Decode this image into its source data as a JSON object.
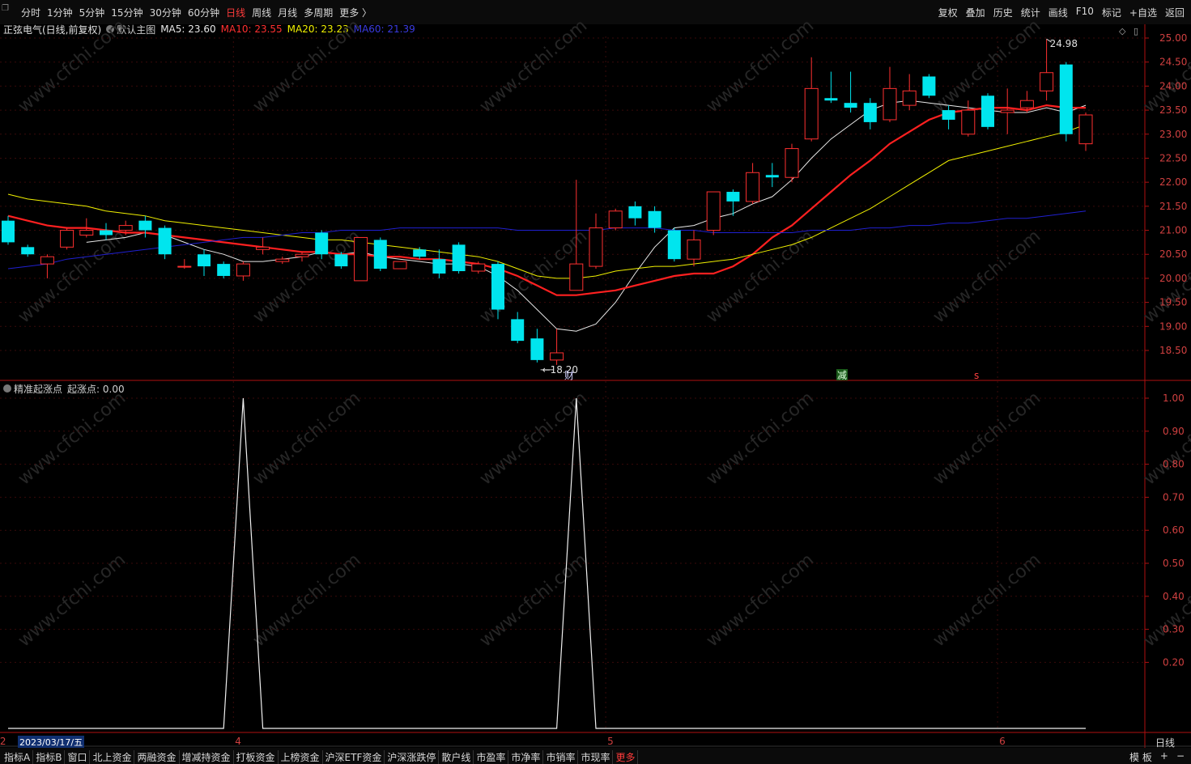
{
  "toolbar": {
    "period_tabs": [
      "分时",
      "1分钟",
      "5分钟",
      "15分钟",
      "30分钟",
      "60分钟",
      "日线",
      "周线",
      "月线",
      "多周期",
      "更多 〉"
    ],
    "active_tab": "日线",
    "right_tools": [
      "复权",
      "叠加",
      "历史",
      "统计",
      "画线",
      "F10",
      "标记",
      "+自选",
      "返回"
    ]
  },
  "main_header": {
    "stock": "正弦电气(日线,前复权)",
    "template": "默认主图",
    "ma5": "MA5: 23.60",
    "ma10": "MA10: 23.55",
    "ma20": "MA20: 23.23",
    "ma60": "MA60: 21.39"
  },
  "sub_header": {
    "indicator": "精准起涨点",
    "value": "起涨点: 0.00"
  },
  "markers": {
    "low_label": "18.20",
    "high_label": "24.98",
    "event_cai": "财",
    "event_jian": "减",
    "event_s": "s"
  },
  "date_label": "2023/03/17/五",
  "period_label": "日线",
  "bottom_tabs": [
    "指标A",
    "指标B",
    "窗口",
    "北上资金",
    "两融资金",
    "增减持资金",
    "打板资金",
    "上榜资金",
    "沪深ETF资金",
    "沪深涨跌停",
    "散户线",
    "市盈率",
    "市净率",
    "市销率",
    "市现率",
    "更多"
  ],
  "bottom_active": "更多",
  "bottom_right": [
    "模 板",
    "+",
    "−"
  ],
  "watermark": "www.cfchi.com",
  "colors": {
    "up": "#ff3030",
    "down": "#00e5ee",
    "ma5": "#e8e8e8",
    "ma10": "#ff2020",
    "ma20": "#f0f000",
    "ma60": "#2020d0",
    "axis": "#b01010"
  },
  "chart_data": [
    {
      "type": "candlestick",
      "title": "正弦电气(日线,前复权)",
      "ylim": [
        18.0,
        25.2
      ],
      "y_ticks": [
        18.5,
        19.0,
        19.5,
        20.0,
        20.5,
        21.0,
        21.5,
        22.0,
        22.5,
        23.0,
        23.5,
        24.0,
        24.5,
        25.0
      ],
      "x_month_labels": [
        {
          "label": "2",
          "index": 0
        },
        {
          "label": "4",
          "index": 12
        },
        {
          "label": "5",
          "index": 31
        },
        {
          "label": "6",
          "index": 51
        }
      ],
      "candles": [
        {
          "o": 21.2,
          "h": 21.3,
          "c": 20.75,
          "l": 20.7
        },
        {
          "o": 20.65,
          "h": 20.7,
          "c": 20.5,
          "l": 20.45
        },
        {
          "o": 20.3,
          "h": 20.5,
          "c": 20.45,
          "l": 20.0
        },
        {
          "o": 20.65,
          "h": 21.05,
          "c": 21.0,
          "l": 20.6
        },
        {
          "o": 20.9,
          "h": 21.25,
          "c": 21.0,
          "l": 20.85
        },
        {
          "o": 21.0,
          "h": 21.15,
          "c": 20.9,
          "l": 20.8
        },
        {
          "o": 21.0,
          "h": 21.2,
          "c": 21.1,
          "l": 20.9
        },
        {
          "o": 21.2,
          "h": 21.3,
          "c": 21.0,
          "l": 20.85
        },
        {
          "o": 21.05,
          "h": 21.1,
          "c": 20.5,
          "l": 20.4
        },
        {
          "o": 20.25,
          "h": 20.4,
          "c": 20.25,
          "l": 20.2
        },
        {
          "o": 20.5,
          "h": 20.6,
          "c": 20.25,
          "l": 20.05
        },
        {
          "o": 20.3,
          "h": 20.35,
          "c": 20.05,
          "l": 20.0
        },
        {
          "o": 20.05,
          "h": 20.35,
          "c": 20.3,
          "l": 19.95
        },
        {
          "o": 20.6,
          "h": 20.85,
          "c": 20.65,
          "l": 20.5
        },
        {
          "o": 20.35,
          "h": 20.45,
          "c": 20.4,
          "l": 20.3
        },
        {
          "o": 20.45,
          "h": 20.55,
          "c": 20.5,
          "l": 20.35
        },
        {
          "o": 20.95,
          "h": 21.0,
          "c": 20.5,
          "l": 20.4
        },
        {
          "o": 20.5,
          "h": 20.55,
          "c": 20.25,
          "l": 20.2
        },
        {
          "o": 19.95,
          "h": 20.85,
          "c": 20.85,
          "l": 19.95
        },
        {
          "o": 20.8,
          "h": 20.85,
          "c": 20.2,
          "l": 20.15
        },
        {
          "o": 20.2,
          "h": 20.35,
          "c": 20.35,
          "l": 20.2
        },
        {
          "o": 20.6,
          "h": 20.65,
          "c": 20.45,
          "l": 20.4
        },
        {
          "o": 20.4,
          "h": 20.6,
          "c": 20.1,
          "l": 20.0
        },
        {
          "o": 20.7,
          "h": 20.75,
          "c": 20.15,
          "l": 20.1
        },
        {
          "o": 20.15,
          "h": 20.35,
          "c": 20.3,
          "l": 20.1
        },
        {
          "o": 20.3,
          "h": 20.35,
          "c": 19.35,
          "l": 19.15
        },
        {
          "o": 19.15,
          "h": 19.3,
          "c": 18.7,
          "l": 18.65
        },
        {
          "o": 18.75,
          "h": 18.95,
          "c": 18.3,
          "l": 18.25
        },
        {
          "o": 18.3,
          "h": 18.95,
          "c": 18.45,
          "l": 18.2
        },
        {
          "o": 19.75,
          "h": 22.05,
          "c": 20.3,
          "l": 19.75
        },
        {
          "o": 20.25,
          "h": 21.35,
          "c": 21.05,
          "l": 20.2
        },
        {
          "o": 21.05,
          "h": 21.45,
          "c": 21.4,
          "l": 21.0
        },
        {
          "o": 21.5,
          "h": 21.6,
          "c": 21.25,
          "l": 21.1
        },
        {
          "o": 21.4,
          "h": 21.5,
          "c": 21.05,
          "l": 20.95
        },
        {
          "o": 21.0,
          "h": 21.05,
          "c": 20.4,
          "l": 20.35
        },
        {
          "o": 20.4,
          "h": 21.0,
          "c": 20.8,
          "l": 20.25
        },
        {
          "o": 21.0,
          "h": 21.8,
          "c": 21.8,
          "l": 20.9
        },
        {
          "o": 21.8,
          "h": 21.85,
          "c": 21.6,
          "l": 21.3
        },
        {
          "o": 21.6,
          "h": 22.4,
          "c": 22.2,
          "l": 21.55
        },
        {
          "o": 22.15,
          "h": 22.4,
          "c": 22.1,
          "l": 21.9
        },
        {
          "o": 22.1,
          "h": 22.8,
          "c": 22.7,
          "l": 22.0
        },
        {
          "o": 22.9,
          "h": 24.6,
          "c": 23.95,
          "l": 22.85
        },
        {
          "o": 23.75,
          "h": 24.3,
          "c": 23.7,
          "l": 23.65
        },
        {
          "o": 23.65,
          "h": 24.3,
          "c": 23.55,
          "l": 23.45
        },
        {
          "o": 23.65,
          "h": 23.75,
          "c": 23.25,
          "l": 23.1
        },
        {
          "o": 23.3,
          "h": 24.4,
          "c": 23.95,
          "l": 23.25
        },
        {
          "o": 23.6,
          "h": 24.25,
          "c": 23.9,
          "l": 23.5
        },
        {
          "o": 24.2,
          "h": 24.25,
          "c": 23.8,
          "l": 23.75
        },
        {
          "o": 23.5,
          "h": 23.6,
          "c": 23.3,
          "l": 23.1
        },
        {
          "o": 23.0,
          "h": 23.7,
          "c": 23.5,
          "l": 22.95
        },
        {
          "o": 23.8,
          "h": 23.85,
          "c": 23.15,
          "l": 23.1
        },
        {
          "o": 23.45,
          "h": 23.95,
          "c": 23.5,
          "l": 23.0
        },
        {
          "o": 23.55,
          "h": 23.9,
          "c": 23.7,
          "l": 23.45
        },
        {
          "o": 23.9,
          "h": 24.98,
          "c": 24.28,
          "l": 23.7
        },
        {
          "o": 24.45,
          "h": 24.5,
          "c": 23.0,
          "l": 22.85
        },
        {
          "o": 22.8,
          "h": 23.45,
          "c": 23.4,
          "l": 22.65
        }
      ],
      "series": [
        {
          "name": "MA5",
          "values": [
            null,
            null,
            null,
            null,
            20.75,
            20.8,
            20.85,
            20.95,
            20.9,
            20.75,
            20.6,
            20.5,
            20.35,
            20.35,
            20.4,
            20.45,
            20.55,
            20.5,
            20.55,
            20.45,
            20.4,
            20.35,
            20.3,
            20.3,
            20.25,
            20.05,
            19.75,
            19.35,
            18.95,
            18.9,
            19.05,
            19.5,
            20.1,
            20.65,
            21.05,
            21.1,
            21.25,
            21.35,
            21.55,
            21.7,
            22.05,
            22.5,
            22.9,
            23.2,
            23.5,
            23.65,
            23.7,
            23.65,
            23.6,
            23.55,
            23.5,
            23.45,
            23.45,
            23.55,
            23.45,
            23.6
          ]
        },
        {
          "name": "MA10",
          "values": [
            21.3,
            21.2,
            21.1,
            21.05,
            21.05,
            21.0,
            20.95,
            20.95,
            20.9,
            20.85,
            20.8,
            20.75,
            20.7,
            20.65,
            20.6,
            20.55,
            20.55,
            20.5,
            20.5,
            20.45,
            20.45,
            20.4,
            20.4,
            20.35,
            20.3,
            20.2,
            20.05,
            19.85,
            19.65,
            19.65,
            19.7,
            19.75,
            19.85,
            19.95,
            20.05,
            20.1,
            20.1,
            20.25,
            20.5,
            20.85,
            21.1,
            21.45,
            21.8,
            22.15,
            22.45,
            22.8,
            23.05,
            23.3,
            23.45,
            23.5,
            23.55,
            23.55,
            23.5,
            23.6,
            23.55,
            23.55
          ]
        },
        {
          "name": "MA20",
          "values": [
            21.75,
            21.65,
            21.6,
            21.55,
            21.5,
            21.4,
            21.35,
            21.3,
            21.2,
            21.15,
            21.1,
            21.05,
            21.0,
            20.95,
            20.9,
            20.85,
            20.8,
            20.8,
            20.75,
            20.7,
            20.65,
            20.6,
            20.55,
            20.5,
            20.45,
            20.35,
            20.2,
            20.05,
            20.0,
            20.0,
            20.05,
            20.15,
            20.2,
            20.25,
            20.25,
            20.3,
            20.35,
            20.4,
            20.5,
            20.6,
            20.7,
            20.85,
            21.05,
            21.25,
            21.45,
            21.7,
            21.95,
            22.2,
            22.45,
            22.55,
            22.65,
            22.75,
            22.85,
            22.95,
            23.05,
            23.2
          ]
        },
        {
          "name": "MA60",
          "values": [
            20.2,
            20.25,
            20.3,
            20.4,
            20.45,
            20.5,
            20.55,
            20.6,
            20.65,
            20.7,
            20.75,
            20.8,
            20.85,
            20.85,
            20.9,
            20.95,
            20.95,
            21.0,
            21.0,
            21.0,
            21.05,
            21.05,
            21.05,
            21.05,
            21.05,
            21.05,
            21.0,
            21.0,
            21.0,
            21.0,
            21.0,
            21.05,
            21.05,
            21.05,
            21.0,
            21.0,
            20.95,
            20.95,
            20.95,
            20.95,
            20.95,
            21.0,
            21.0,
            21.0,
            21.05,
            21.05,
            21.1,
            21.1,
            21.15,
            21.15,
            21.2,
            21.25,
            21.25,
            21.3,
            21.35,
            21.4
          ]
        }
      ]
    },
    {
      "type": "line",
      "title": "精准起涨点",
      "ylim": [
        0,
        1.02
      ],
      "y_ticks": [
        0.2,
        0.3,
        0.4,
        0.5,
        0.6,
        0.7,
        0.8,
        0.9,
        1.0
      ],
      "series": [
        {
          "name": "起涨点",
          "values": [
            0,
            0,
            0,
            0,
            0,
            0,
            0,
            0,
            0,
            0,
            0,
            0,
            1,
            0,
            0,
            0,
            0,
            0,
            0,
            0,
            0,
            0,
            0,
            0,
            0,
            0,
            0,
            0,
            0,
            1,
            0,
            0,
            0,
            0,
            0,
            0,
            0,
            0,
            0,
            0,
            0,
            0,
            0,
            0,
            0,
            0,
            0,
            0,
            0,
            0,
            0,
            0,
            0,
            0,
            0,
            0
          ]
        }
      ]
    }
  ]
}
